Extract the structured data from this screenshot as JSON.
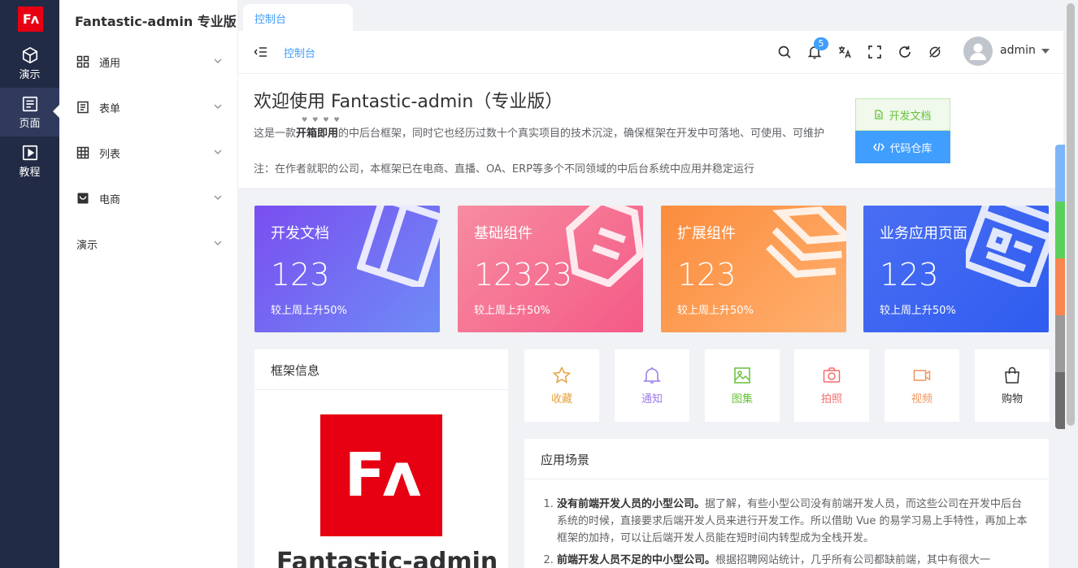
{
  "rail": {
    "logo": "Fʌ",
    "items": [
      {
        "label": "演示",
        "icon": "cube-icon"
      },
      {
        "label": "页面",
        "icon": "page-icon"
      },
      {
        "label": "教程",
        "icon": "play-icon"
      }
    ]
  },
  "sidebar": {
    "title": "Fantastic-admin 专业版",
    "items": [
      {
        "label": "通用",
        "icon": "grid-icon"
      },
      {
        "label": "表单",
        "icon": "form-icon"
      },
      {
        "label": "列表",
        "icon": "table-icon"
      },
      {
        "label": "电商",
        "icon": "shop-icon"
      },
      {
        "label": "演示",
        "icon": ""
      }
    ]
  },
  "tabs": [
    {
      "label": "控制台"
    }
  ],
  "header": {
    "breadcrumb": "控制台",
    "notify_count": "5",
    "username": "admin"
  },
  "welcome": {
    "title": "欢迎使用 Fantastic-admin（专业版）",
    "desc_prefix": "这是一款",
    "desc_bold": "开箱即用",
    "desc_suffix": "的中后台框架，同时它也经历过数十个真实项目的技术沉淀，确保框架在开发中可落地、可使用、可维护",
    "note": "注：在作者就职的公司，本框架已在电商、直播、OA、ERP等多个不同领域的中后台系统中应用并稳定运行",
    "btn_doc": "开发文档",
    "btn_repo": "代码仓库"
  },
  "stats": [
    {
      "title": "开发文档",
      "value": "123",
      "trend": "较上周上升50%"
    },
    {
      "title": "基础组件",
      "value": "12323",
      "trend": "较上周上升50%"
    },
    {
      "title": "扩展组件",
      "value": "123",
      "trend": "较上周上升50%"
    },
    {
      "title": "业务应用页面",
      "value": "123",
      "trend": "较上周上升50%"
    }
  ],
  "info": {
    "title": "框架信息",
    "logo": "Fʌ",
    "name": "Fantastic-admin"
  },
  "quick": [
    {
      "label": "收藏",
      "icon": "star-icon",
      "color": "#e6a23c"
    },
    {
      "label": "通知",
      "icon": "bell-icon",
      "color": "#9b7ce6"
    },
    {
      "label": "图集",
      "icon": "image-icon",
      "color": "#67c23a"
    },
    {
      "label": "拍照",
      "icon": "camera-icon",
      "color": "#f56c6c"
    },
    {
      "label": "视频",
      "icon": "video-icon",
      "color": "#f2935c"
    },
    {
      "label": "购物",
      "icon": "bag-icon",
      "color": "#303133"
    }
  ],
  "scenes": {
    "title": "应用场景",
    "items": [
      {
        "bold": "没有前端开发人员的小型公司。",
        "text": "据了解，有些小型公司没有前端开发人员，而这些公司在开发中后台系统的时候，直接要求后端开发人员来进行开发工作。所以借助 Vue 的易学习易上手特性，再加上本框架的加持，可以让后端开发人员能在短时间内转型成为全栈开发。"
      },
      {
        "bold": "前端开发人员不足的中小型公司。",
        "text": "根据招聘网站统计，几乎所有公司都缺前端，其中有很大一"
      }
    ]
  },
  "colors": {
    "primary": "#409eff",
    "rail_bg": "#222b45",
    "brand_red": "#e60012"
  }
}
